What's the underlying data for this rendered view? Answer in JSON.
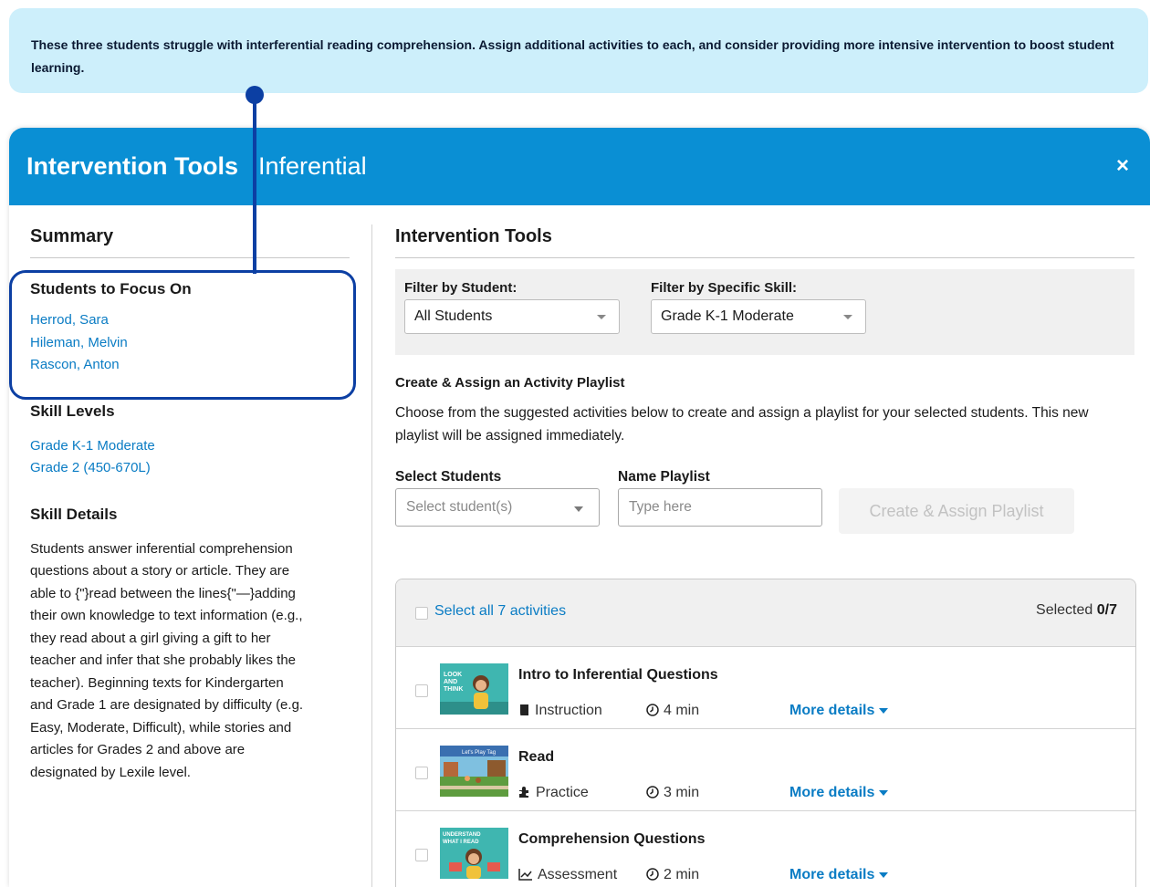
{
  "callout": {
    "text": "These three students struggle with interferential reading comprehension. Assign additional activities to each, and consider providing more intensive intervention to boost student learning."
  },
  "modal": {
    "title": "Intervention Tools",
    "subtitle": "Inferential",
    "close_label": "×"
  },
  "summary": {
    "heading": "Summary",
    "focus_heading": "Students to Focus On",
    "students": [
      "Herrod, Sara",
      "Hileman, Melvin",
      "Rascon, Anton"
    ],
    "skill_levels_heading": "Skill Levels",
    "skill_levels": [
      "Grade K-1 Moderate",
      "Grade 2 (450-670L)"
    ],
    "skill_details_heading": "Skill Details",
    "skill_details": "Students answer inferential comprehension questions about a story or article. They are able to {\"}read between the lines{\"—}adding their own knowledge to text information (e.g., they read about a girl giving a gift to her teacher and infer that she probably likes the teacher). Beginning texts for Kindergarten and Grade 1 are designated by difficulty (e.g. Easy, Moderate, Difficult), while stories and articles for Grades 2 and above are designated by Lexile level."
  },
  "tools": {
    "heading": "Intervention Tools",
    "filter_student_label": "Filter by Student:",
    "filter_student_value": "All Students",
    "filter_skill_label": "Filter by Specific Skill:",
    "filter_skill_value": "Grade K-1 Moderate",
    "create_title": "Create & Assign an Activity Playlist",
    "create_desc": "Choose from the suggested activities below to create and assign a playlist for your selected students. This new playlist will be assigned immediately.",
    "select_students_label": "Select Students",
    "select_students_placeholder": "Select student(s)",
    "name_playlist_label": "Name Playlist",
    "name_playlist_placeholder": "Type here",
    "assign_button": "Create & Assign Playlist"
  },
  "activities": {
    "select_all": "Select all 7 activities",
    "selected_prefix": "Selected ",
    "selected_count": "0/7",
    "more_details": "More details",
    "items": [
      {
        "name": "Intro to Inferential Questions",
        "type": "Instruction",
        "type_icon": "book-icon",
        "time": "4 min",
        "thumb_text": "LOOK AND THINK"
      },
      {
        "name": "Read",
        "type": "Practice",
        "type_icon": "puzzle-icon",
        "time": "3 min",
        "thumb_text": "Let's Play Tag"
      },
      {
        "name": "Comprehension Questions",
        "type": "Assessment",
        "type_icon": "chart-icon",
        "time": "2 min",
        "thumb_text": "UNDERSTAND WHAT I READ"
      }
    ]
  },
  "colors": {
    "header_blue": "#0a8fd4",
    "link_blue": "#0a7cc4",
    "callout_bg": "#cdeffb",
    "annotation_navy": "#0c3fa3"
  }
}
